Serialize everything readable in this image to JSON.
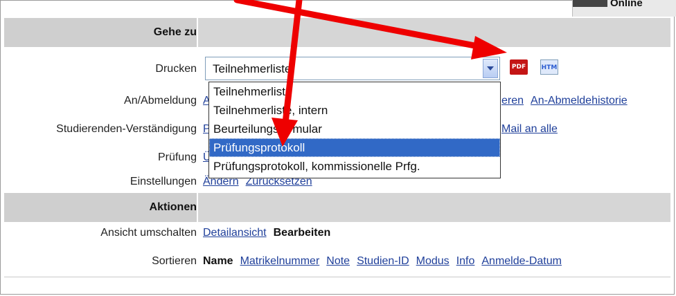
{
  "top_badge": {
    "text": "Online"
  },
  "rows": {
    "gehe_zu": {
      "label": "Gehe zu"
    },
    "drucken": {
      "label": "Drucken",
      "select_value": "Teilnehmerliste"
    },
    "an_abmeldung": {
      "label": "An/Abmeldung",
      "links": [
        "A",
        "eren",
        "An-Abmeldehistorie"
      ]
    },
    "verstaendigung": {
      "label": "Studierenden-Verständigung",
      "links": [
        "P",
        "Mail an alle"
      ]
    },
    "pruefung": {
      "label": "Prüfung",
      "links": [
        "Ü"
      ]
    },
    "einstellungen": {
      "label": "Einstellungen",
      "links": [
        "Ändern",
        "Zurücksetzen"
      ]
    },
    "aktionen": {
      "label": "Aktionen"
    },
    "ansicht": {
      "label": "Ansicht umschalten",
      "link": "Detailansicht",
      "active": "Bearbeiten"
    },
    "sortieren": {
      "label": "Sortieren",
      "active": "Name",
      "links": [
        "Matrikelnummer",
        "Note",
        "Studien-ID",
        "Modus",
        "Info",
        "Anmelde-Datum"
      ]
    }
  },
  "icons": {
    "pdf_label": "PDF",
    "htm_label": "HTM"
  },
  "dropdown": {
    "options": [
      "Teilnehmerliste",
      "Teilnehmerliste, intern",
      "Beurteilungsformular",
      "Prüfungsprotokoll",
      "Prüfungsprotokoll, kommissionelle Prfg."
    ],
    "selected_index": 3
  },
  "colors": {
    "annotation_arrow": "#ee0000",
    "selection": "#3169c6",
    "link": "#1f3f9a"
  }
}
